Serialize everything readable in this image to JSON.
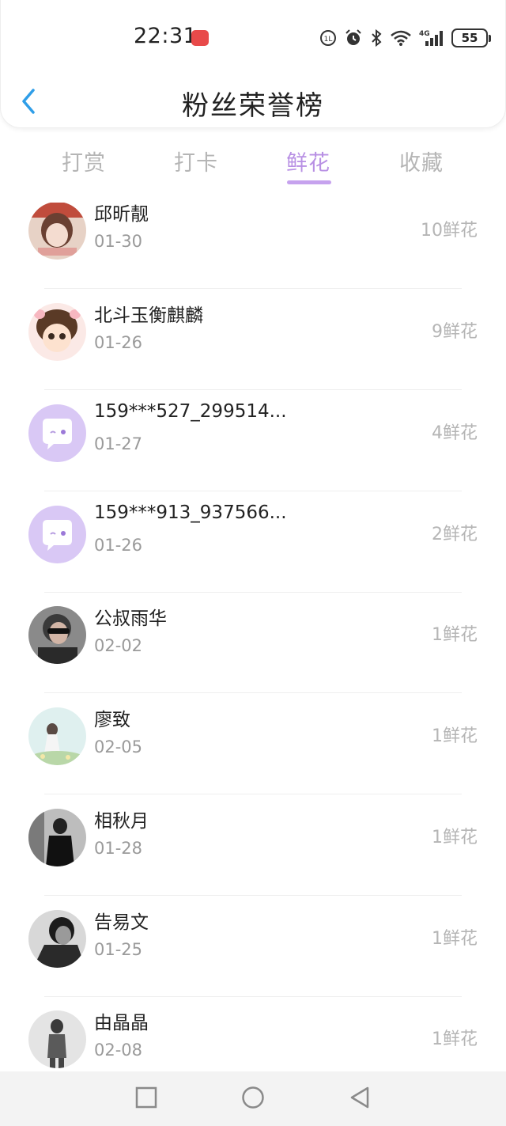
{
  "status_bar": {
    "time": "22:31",
    "battery": "55",
    "icons": [
      "volte-icon",
      "alarm-icon",
      "bluetooth-icon",
      "wifi-icon",
      "signal-4g-icon",
      "battery-icon"
    ]
  },
  "header": {
    "title": "粉丝荣誉榜",
    "back_icon": "chevron-left-icon"
  },
  "tabs": [
    {
      "label": "打赏",
      "active": false
    },
    {
      "label": "打卡",
      "active": false
    },
    {
      "label": "鲜花",
      "active": true
    },
    {
      "label": "收藏",
      "active": false
    }
  ],
  "fans": [
    {
      "name": "邱昕靓",
      "date": "01-30",
      "count": "10鲜花",
      "avatar": "photo-girl"
    },
    {
      "name": "北斗玉衡麒麟",
      "date": "01-26",
      "count": "9鲜花",
      "avatar": "cartoon-boy"
    },
    {
      "name": "159***527_299514...",
      "date": "01-27",
      "count": "4鲜花",
      "avatar": "default-chat"
    },
    {
      "name": "159***913_937566...",
      "date": "01-26",
      "count": "2鲜花",
      "avatar": "default-chat"
    },
    {
      "name": "公叔雨华",
      "date": "02-02",
      "count": "1鲜花",
      "avatar": "photo-man-sunglasses"
    },
    {
      "name": "廖致",
      "date": "02-05",
      "count": "1鲜花",
      "avatar": "photo-flowers"
    },
    {
      "name": "相秋月",
      "date": "01-28",
      "count": "1鲜花",
      "avatar": "photo-dark"
    },
    {
      "name": "告易文",
      "date": "01-25",
      "count": "1鲜花",
      "avatar": "photo-man-bw"
    },
    {
      "name": "由晶晶",
      "date": "02-08",
      "count": "1鲜花",
      "avatar": "photo-standing"
    }
  ],
  "navbar": {
    "icons": [
      "recent-apps-icon",
      "home-icon",
      "back-icon"
    ]
  },
  "colors": {
    "accent": "#b890e4",
    "inactive_tab": "#b5b5b5",
    "back_arrow": "#2f9ee8",
    "default_avatar_bg": "#d9c8f5"
  }
}
